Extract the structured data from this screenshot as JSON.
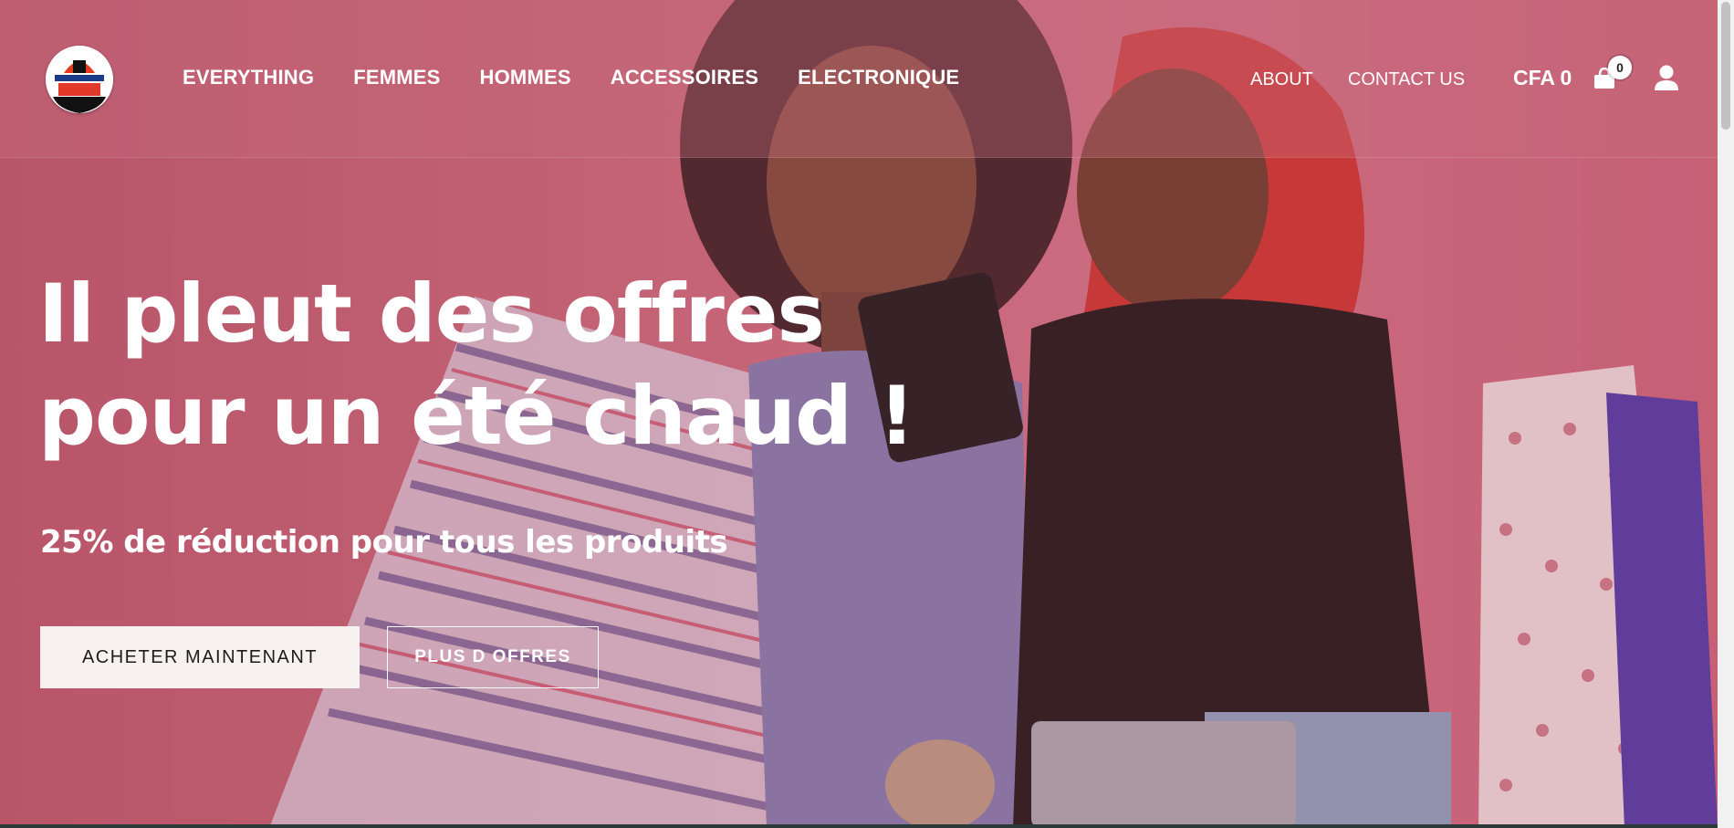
{
  "header": {
    "nav_main": [
      "EVERYTHING",
      "FEMMES",
      "HOMMES",
      "ACCESSOIRES",
      "ELECTRONIQUE"
    ],
    "nav_right": [
      "ABOUT",
      "CONTACT US"
    ],
    "cart_total": "CFA 0",
    "cart_count": "0"
  },
  "hero": {
    "headline_line1": "Il pleut des offres",
    "headline_line2": "pour un été chaud !",
    "subline": "25% de réduction pour tous les produits",
    "primary_cta": "ACHETER MAINTENANT",
    "secondary_cta": "PLUS D OFFRES"
  },
  "icons": {
    "logo": "logo-icon",
    "cart": "cart-icon",
    "user": "user-icon"
  },
  "colors": {
    "hero_tint": "#c46778",
    "primary_button_bg": "#f7f2ef",
    "text": "#ffffff"
  }
}
